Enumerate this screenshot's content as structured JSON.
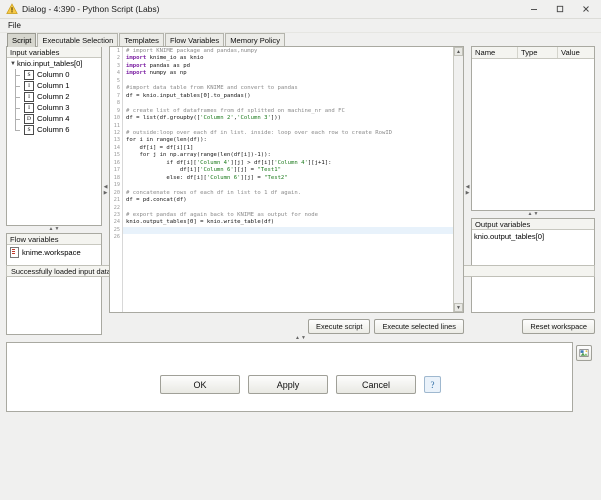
{
  "window": {
    "title": "Dialog - 4:390 - Python Script (Labs)",
    "icon": "warning-triangle-icon",
    "minimize": "–",
    "maximize": "☐",
    "close": "×"
  },
  "menubar": {
    "items": [
      {
        "label": "File"
      }
    ]
  },
  "tabs": [
    {
      "label": "Script",
      "active": true
    },
    {
      "label": "Executable Selection",
      "active": false
    },
    {
      "label": "Templates",
      "active": false
    },
    {
      "label": "Flow Variables",
      "active": false
    },
    {
      "label": "Memory Policy",
      "active": false
    }
  ],
  "input_variables": {
    "header": "Input variables",
    "root": "knio.input_tables[0]",
    "columns": [
      {
        "type": "S",
        "label": "Column 0"
      },
      {
        "type": "I",
        "label": "Column 1"
      },
      {
        "type": "I",
        "label": "Column 2"
      },
      {
        "type": "I",
        "label": "Column 3"
      },
      {
        "type": "D",
        "label": "Column 4"
      },
      {
        "type": "S",
        "label": "Column 6"
      }
    ]
  },
  "flow_variables": {
    "header": "Flow variables",
    "items": [
      {
        "label": "knime.workspace"
      }
    ]
  },
  "editor": {
    "line_numbers": [
      1,
      2,
      3,
      4,
      5,
      6,
      7,
      8,
      9,
      10,
      11,
      12,
      13,
      14,
      15,
      16,
      17,
      18,
      19,
      20,
      21,
      22,
      23,
      24,
      25,
      26
    ],
    "lines": [
      [
        {
          "t": "# import KNIME package and pandas,numpy",
          "c": "cm"
        }
      ],
      [
        {
          "t": "import",
          "c": "kw"
        },
        {
          "t": " knime_io as knio",
          "c": "nm"
        }
      ],
      [
        {
          "t": "import",
          "c": "kw"
        },
        {
          "t": " pandas as pd",
          "c": "nm"
        }
      ],
      [
        {
          "t": "import",
          "c": "kw"
        },
        {
          "t": " numpy as np",
          "c": "nm"
        }
      ],
      [],
      [
        {
          "t": "#import data table from KNIME and convert to pandas",
          "c": "cm"
        }
      ],
      [
        {
          "t": "df = knio.input_tables[0].to_pandas()",
          "c": "nm"
        }
      ],
      [],
      [
        {
          "t": "# create list of dataframes from df splitted on machine_nr and FC",
          "c": "cm"
        }
      ],
      [
        {
          "t": "df = list(df.groupby([",
          "c": "nm"
        },
        {
          "t": "'Column 2'",
          "c": "st"
        },
        {
          "t": ",",
          "c": "nm"
        },
        {
          "t": "'Column 3'",
          "c": "st"
        },
        {
          "t": "]))",
          "c": "nm"
        }
      ],
      [],
      [
        {
          "t": "# outside:loop over each df in list. inside: loop over each row to create RowID",
          "c": "cm"
        }
      ],
      [
        {
          "t": "for i in range(len(df)):",
          "c": "nm"
        }
      ],
      [
        {
          "t": "    df[i] = df[i][1]",
          "c": "nm"
        }
      ],
      [
        {
          "t": "    for j in np.array(range(len(df[i])-1)):",
          "c": "nm"
        }
      ],
      [
        {
          "t": "            if df[i][",
          "c": "nm"
        },
        {
          "t": "'Column 4'",
          "c": "st"
        },
        {
          "t": "][j] > df[i][",
          "c": "nm"
        },
        {
          "t": "'Column 4'",
          "c": "st"
        },
        {
          "t": "][j+1]:",
          "c": "nm"
        }
      ],
      [
        {
          "t": "                df[i][",
          "c": "nm"
        },
        {
          "t": "'Column 6'",
          "c": "st"
        },
        {
          "t": "][j] = ",
          "c": "nm"
        },
        {
          "t": "\"Test1\"",
          "c": "st"
        }
      ],
      [
        {
          "t": "            else: df[i][",
          "c": "nm"
        },
        {
          "t": "'Column 6'",
          "c": "st"
        },
        {
          "t": "][j] = ",
          "c": "nm"
        },
        {
          "t": "\"Test2\"",
          "c": "st"
        }
      ],
      [],
      [
        {
          "t": "# concatenate rows of each df in list to 1 df again.",
          "c": "cm"
        }
      ],
      [
        {
          "t": "df = pd.concat(df)",
          "c": "nm"
        }
      ],
      [],
      [
        {
          "t": "# export pandas df again back to KNIME as output for node",
          "c": "cm"
        }
      ],
      [
        {
          "t": "knio.output_tables[0] = knio.write_table(df)",
          "c": "nm"
        }
      ],
      [],
      []
    ],
    "current_line": 25,
    "buttons": {
      "execute_script": "Execute script",
      "execute_selected": "Execute selected lines"
    }
  },
  "workspace_table": {
    "headers": [
      "Name",
      "Type",
      "Value"
    ],
    "rows": []
  },
  "output_variables": {
    "header": "Output variables",
    "items": [
      {
        "label": "knio.output_tables[0]"
      }
    ]
  },
  "reset_button": {
    "label": "Reset workspace"
  },
  "console": {
    "text": "",
    "image_button_icon": "image-icon"
  },
  "statusbar": {
    "message": "Successfully loaded input data into Python"
  },
  "footer": {
    "ok": "OK",
    "apply": "Apply",
    "cancel": "Cancel",
    "help": "?"
  },
  "colors": {
    "accent": "#2f6ea5",
    "comment": "#8a8a8a",
    "keyword": "#7b1fa2",
    "string": "#1b7a1b",
    "current_line": "#e8f2fb"
  }
}
